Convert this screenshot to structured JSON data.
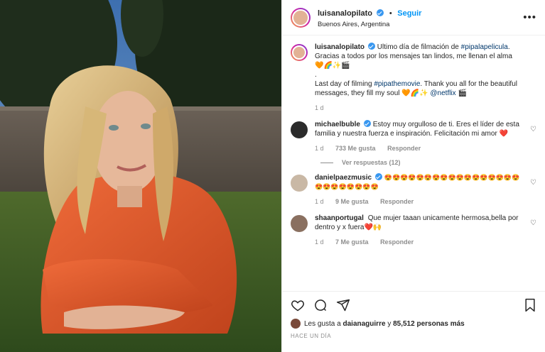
{
  "post": {
    "author": "luisanalopilato",
    "follow_label": "Seguir",
    "separator": "•",
    "location": "Buenos Aires, Argentina",
    "more_label": "•••"
  },
  "caption": {
    "user": "luisanalopilato",
    "line1_text": "Ultimo día de filmación de ",
    "line1_hashtag": "#pipalapelicula",
    "line1_end": ". Gracias a todos por los mensajes tan lindos, me llenan el alma 🧡🌈✨🎬",
    "dot": ".",
    "line2_text": "Last day of filming ",
    "line2_hashtag": "#pipathemovie",
    "line2_end": ". Thank you all for the beautiful messages, they fill my soul 🧡🌈✨ ",
    "line2_mention": "@netflix",
    "line2_emoji": " 🎬",
    "time": "1 d"
  },
  "comments": [
    {
      "user": "michaelbuble",
      "text": "Estoy muy orgulloso de ti. Eres el líder de esta familia y nuestra fuerza e inspiración. Felicitación mi amor ❤️",
      "time": "1 d",
      "likes": "733 Me gusta",
      "reply": "Responder"
    },
    {
      "user": "danielpaezmusic",
      "text": "😍😍😍😍😍😍😍😍😍😍😍😍😍😍😍😍😍😍😍😍😍😍😍😍😍",
      "time": "1 d",
      "likes": "9 Me gusta",
      "reply": "Responder"
    },
    {
      "user": "shaanportugal",
      "text": "Que mujer taaan unicamente hermosa,bella por dentro y x fuera❤️🙌",
      "time": "1 d",
      "likes": "7 Me gusta",
      "reply": "Responder"
    }
  ],
  "view_replies": "Ver respuestas (12)",
  "footer": {
    "likes_prefix": "Les gusta a ",
    "likes_user": "daianaguirre",
    "likes_mid": " y ",
    "likes_count": "85,512 personas más",
    "ago": "HACE UN DÍA"
  },
  "colors": {
    "link": "#0095f6",
    "verified": "#3897f0",
    "hashtag": "#00376b",
    "jacket": "#e0552a"
  },
  "icons": [
    "heart-icon",
    "comment-icon",
    "share-icon",
    "bookmark-icon",
    "verified-icon",
    "more-icon"
  ]
}
